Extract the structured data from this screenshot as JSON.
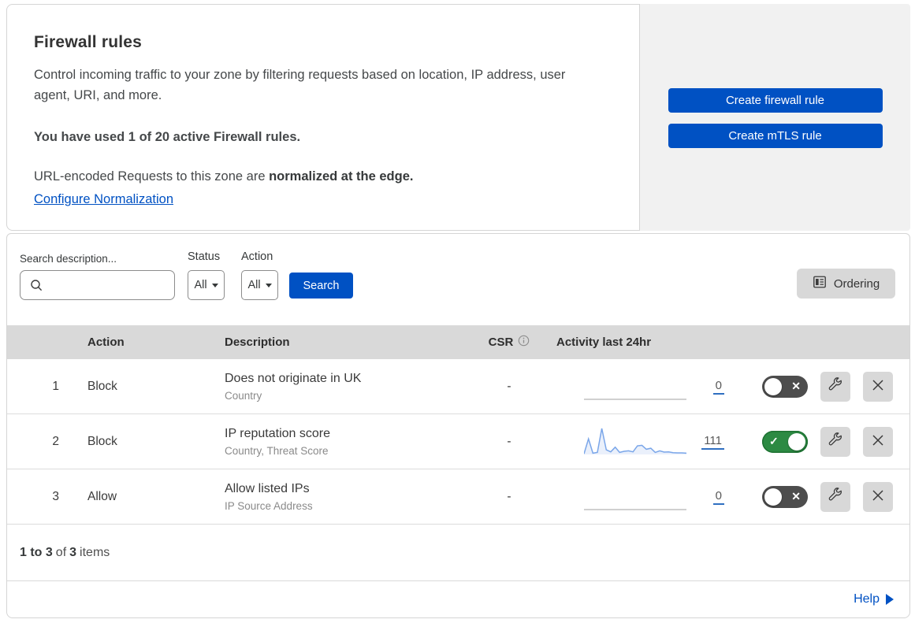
{
  "header": {
    "title": "Firewall rules",
    "description": "Control incoming traffic to your zone by filtering requests based on location, IP address, user agent, URI, and more.",
    "usage_notice": "You have used 1 of 20 active Firewall rules.",
    "normalization_prefix": "URL-encoded Requests to this zone are ",
    "normalization_bold": "normalized at the edge.",
    "normalization_link": "Configure Normalization",
    "buttons": {
      "create_firewall_rule": "Create firewall rule",
      "create_mtls_rule": "Create mTLS rule"
    }
  },
  "filters": {
    "search_label": "Search description...",
    "search_value": "",
    "status_label": "Status",
    "status_value": "All",
    "action_label": "Action",
    "action_value": "All",
    "search_button": "Search",
    "ordering_button": "Ordering"
  },
  "table": {
    "columns": {
      "action": "Action",
      "description": "Description",
      "csr": "CSR",
      "activity": "Activity last 24hr"
    },
    "rows": [
      {
        "priority": "1",
        "action": "Block",
        "description": "Does not originate in UK",
        "fields": "Country",
        "csr": "-",
        "activity_count": "0",
        "enabled": false,
        "sparkline": null
      },
      {
        "priority": "2",
        "action": "Block",
        "description": "IP reputation score",
        "fields": "Country, Threat Score",
        "csr": "-",
        "activity_count": "111",
        "enabled": true,
        "sparkline": [
          2,
          60,
          5,
          8,
          100,
          18,
          10,
          28,
          8,
          12,
          14,
          10,
          33,
          35,
          20,
          24,
          8,
          14,
          9,
          10,
          7,
          6,
          6,
          5
        ]
      },
      {
        "priority": "3",
        "action": "Allow",
        "description": "Allow listed IPs",
        "fields": "IP Source Address",
        "csr": "-",
        "activity_count": "0",
        "enabled": false,
        "sparkline": null
      }
    ]
  },
  "footer": {
    "range": "1 to 3",
    "of_word": "of",
    "total": "3",
    "items_word": "items",
    "help_label": "Help"
  },
  "icons": {
    "check": "✓",
    "cross": "✕"
  },
  "colors": {
    "accent_blue": "#0051c3",
    "toggle_on_green": "#2c8a43",
    "toggle_off_gray": "#4d4d4d",
    "sparkline_blue": "#7aa6e9",
    "panel_gray": "#f1f1f1",
    "table_header_gray": "#d9d9d9"
  }
}
